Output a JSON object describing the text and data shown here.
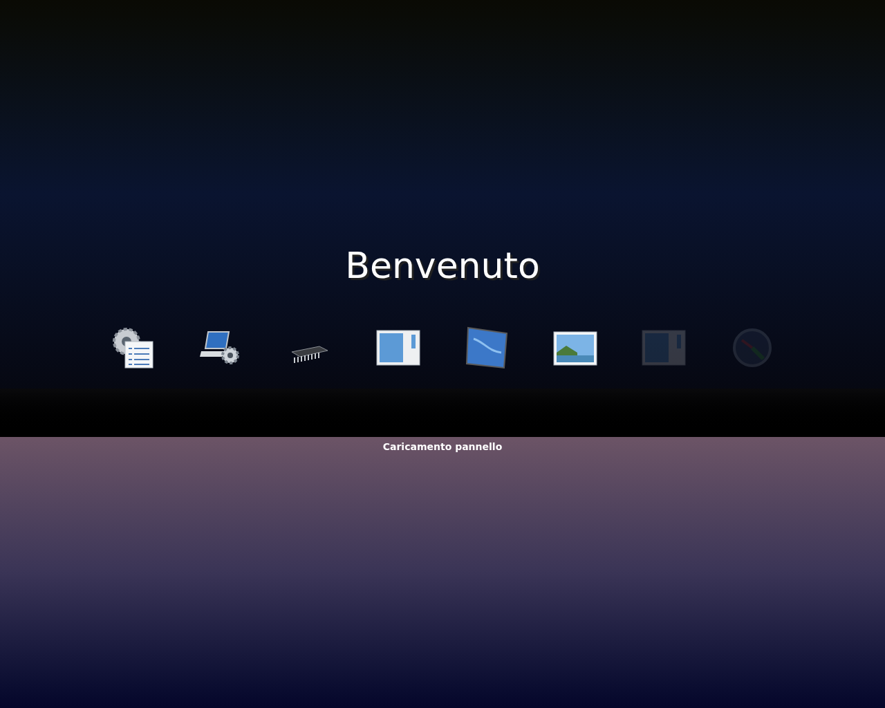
{
  "title": "Benvenuto",
  "steps": [
    {
      "kind": "settings",
      "loaded": true
    },
    {
      "kind": "laptop",
      "loaded": true
    },
    {
      "kind": "chip",
      "loaded": true
    },
    {
      "kind": "window",
      "loaded": true
    },
    {
      "kind": "tile",
      "loaded": true
    },
    {
      "kind": "photo",
      "loaded": true
    },
    {
      "kind": "window",
      "loaded": false
    },
    {
      "kind": "dial",
      "loaded": false
    }
  ],
  "status": "Caricamento pannello"
}
